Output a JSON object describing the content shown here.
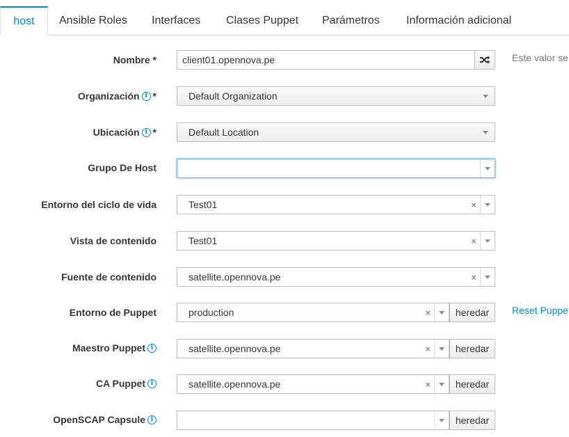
{
  "tabs": [
    {
      "label": "host",
      "active": true
    },
    {
      "label": "Ansible Roles"
    },
    {
      "label": "Interfaces"
    },
    {
      "label": "Clases Puppet"
    },
    {
      "label": "Parámetros"
    },
    {
      "label": "Información adicional"
    }
  ],
  "form": {
    "nombre": {
      "label": "Nombre *",
      "value": "client01.opennova.pe",
      "help": "Este valor se"
    },
    "organizacion": {
      "label": "Organización",
      "required": "*",
      "value": "Default Organization"
    },
    "ubicacion": {
      "label": "Ubicación",
      "required": "*",
      "value": "Default Location"
    },
    "grupo_host": {
      "label": "Grupo De Host",
      "value": ""
    },
    "entorno_ciclo": {
      "label": "Entorno del ciclo de vida",
      "value": "Test01"
    },
    "vista_contenido": {
      "label": "Vista de contenido",
      "value": "Test01"
    },
    "fuente_contenido": {
      "label": "Fuente de contenido",
      "value": "satellite.opennova.pe"
    },
    "entorno_puppet": {
      "label": "Entorno de Puppet",
      "value": "production",
      "button": "heredar",
      "link": "Reset Puppet"
    },
    "maestro_puppet": {
      "label": "Maestro Puppet",
      "value": "satellite.opennova.pe",
      "button": "heredar"
    },
    "ca_puppet": {
      "label": "CA Puppet",
      "value": "satellite.opennova.pe",
      "button": "heredar"
    },
    "openscap": {
      "label": "OpenSCAP Capsule",
      "value": "",
      "button": "heredar"
    }
  },
  "icons": {
    "info": "i",
    "clear": "×"
  },
  "colors": {
    "accent": "#0088ce",
    "focus": "#66afe9"
  }
}
